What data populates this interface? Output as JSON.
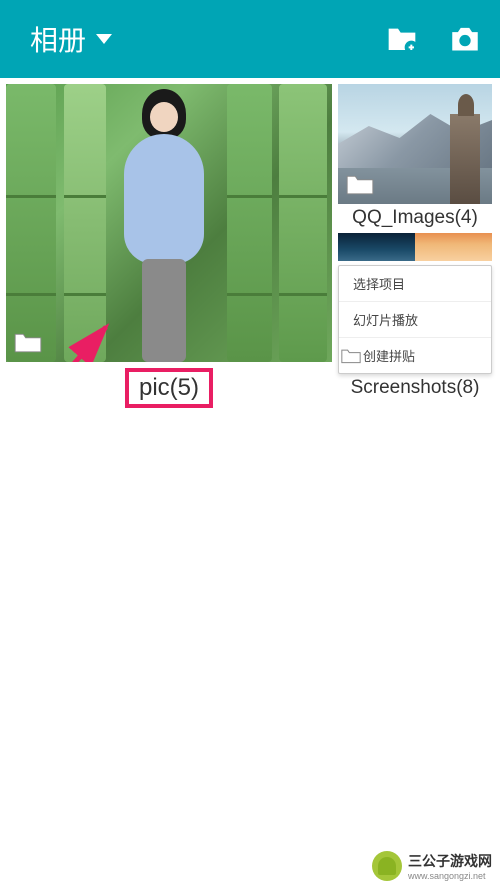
{
  "header": {
    "title": "相册",
    "icons": {
      "add_folder": "add-folder-icon",
      "camera": "camera-icon"
    }
  },
  "albums": [
    {
      "name": "pic(5)",
      "highlighted": true,
      "folder_icon": "folder-icon"
    },
    {
      "name": "QQ_Images(4)",
      "folder_icon": "folder-icon"
    },
    {
      "name": "Screenshots(8)",
      "folder_icon": "folder-icon"
    }
  ],
  "context_menu": {
    "items": [
      "选择项目",
      "幻灯片播放",
      "创建拼贴"
    ]
  },
  "watermark": {
    "brand": "三公子游戏网",
    "url": "www.sangongzi.net"
  },
  "colors": {
    "header_bg": "#00a5b5",
    "highlight": "#e91e63",
    "android_green": "#a4c639"
  }
}
